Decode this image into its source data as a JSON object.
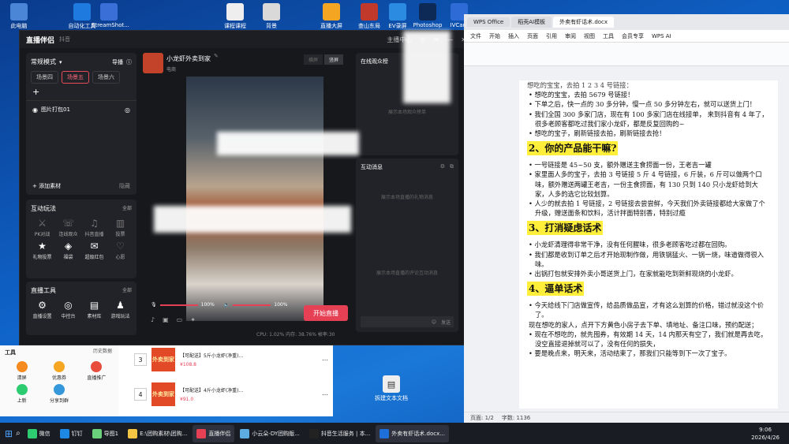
{
  "desktop": {
    "icons": [
      {
        "label": "此电脑"
      },
      {
        "label": "自动化工具"
      },
      {
        "label": "StreamShot..."
      },
      {
        "label": "课程课程"
      },
      {
        "label": "背景"
      },
      {
        "label": "直播大屏"
      },
      {
        "label": "查山东局"
      },
      {
        "label": "EV录屏"
      },
      {
        "label": "Photoshop"
      },
      {
        "label": "IVCam"
      }
    ],
    "bottom_file": "拆建文本文档"
  },
  "live_window": {
    "app_name": "直播伴侣",
    "platform": "抖音",
    "header_right": [
      "主播中心"
    ],
    "mode_label": "常规模式",
    "guide_label": "导播",
    "scenes": [
      "场景四",
      "场景五",
      "场景六"
    ],
    "active_scene": "场景五",
    "source_item": "图片打包01",
    "add_material": "添加素材",
    "hide_label": "隐藏",
    "interactive_title": "互动玩法",
    "all_label": "全部",
    "interactive_tools": [
      {
        "label": "PK对战",
        "enabled": false
      },
      {
        "label": "连线观众",
        "enabled": false
      },
      {
        "label": "抖音直播",
        "enabled": false
      },
      {
        "label": "投票",
        "enabled": false
      },
      {
        "label": "礼物投票",
        "enabled": true
      },
      {
        "label": "福袋",
        "enabled": true
      },
      {
        "label": "超级红包",
        "enabled": true
      },
      {
        "label": "心愿",
        "enabled": false
      }
    ],
    "live_tools_title": "直播工具",
    "live_tools": [
      {
        "label": "直播设置"
      },
      {
        "label": "中控台"
      },
      {
        "label": "素材库"
      },
      {
        "label": "游戏玩法"
      }
    ],
    "streamer_name": "小龙虾外卖到家",
    "streamer_tag": "电商",
    "orientation_options": [
      "横屏",
      "竖屏"
    ],
    "mic_volume": "100%",
    "speaker_volume": "100%",
    "start_live_label": "开始直播",
    "perf_status": "CPU: 1.02%  内存: 38.76%  帧率:30",
    "viewers_title": "在线观众榜",
    "viewers_empty": "展示本场观众榜单",
    "interact_title": "互动消息",
    "gift_empty": "展示本场直播的礼物消息",
    "comment_empty": "展示本场直播的评论互动消息",
    "chat_send": "发送"
  },
  "shop": {
    "left_title": "工具",
    "left_tools": [
      "清屏",
      "优惠券",
      "直播推广",
      "上新",
      "分享到群"
    ],
    "history_label": "历史数据",
    "products": [
      {
        "index": "3",
        "thumb": "外卖到家",
        "title": "【可配送】5斤小龙虾(净重)...",
        "price": "¥108.8"
      },
      {
        "index": "4",
        "thumb": "外卖到家",
        "title": "【可配送】4斤小龙虾(净重)...",
        "price": "¥91.0"
      }
    ]
  },
  "wps": {
    "tabs": [
      "WPS Office",
      "稻壳AI模板",
      "外卖有虾话术.docx"
    ],
    "active_tab": "外卖有虾话术.docx",
    "menu": [
      "文件",
      "开始",
      "插入",
      "页面",
      "引用",
      "审阅",
      "视图",
      "工具",
      "会员专享",
      "WPS AI"
    ],
    "doc": {
      "top_line": "想吃的宝宝，去拍 1 2 3 4 号链接：",
      "section1_bullets": [
        "• 想吃的宝宝，去拍 5679 号链接！",
        "• 下单之后，快一点的 30 多分钟，慢一点 50 多分钟左右，就可以送货上门！",
        "• 我们全国 300 多家门店，现在有 100 多家门店在线接单， 来到抖音有 4 年了，很多老顾客都吃过我们家小龙虾，都是反复回购的~",
        "• 想吃的宝子，刷新链接去拍，刷新链接去抢！"
      ],
      "h2": "2、你的产品能干嘛?",
      "section2_bullets": [
        "• 一号链接是 45~50 支，额外赠送主食捞面一份，王老吉一罐",
        "• 家里面人多的宝子，去拍 3 号链接 5 斤  4 号链接，6 斤装，6 斤可以做两个口味，额外赠送两罐王老吉，一份主食捞面，有 130 只到 140 只小龙虾给到大家，人多的选它比较划算。",
        "• 人少的就去拍 1 号链接，2 号链接去尝尝鲜，今天我们外卖链接都给大家做了个升级，赠送面条和饮料，活计拌面特别香，特别过瘾"
      ],
      "h3": "3、打消疑虑话术",
      "section3_bullets": [
        "• 小龙虾清理得非常干净，没有任何腥味，很多老顾客吃过都在回购。",
        "• 我们都是收到订单之后才开始现制作做，用铁锅猛火、一锅一烧，味道做得很入味。",
        "• 出锅打包就安排外卖小哥送货上门，在家就能吃到新鲜现烧的小龙虾。"
      ],
      "h4": "4、逼单话术",
      "section4_lines": [
        "• 今天给线下门店做宣传，给品质做品宣，才有这么划算的价格，错过就没这个价了。",
        "现在想吃的家人，点开下方黄色小房子去下单、填地址、备注口味，预约配送；",
        "• 现在不想吃的，就先囤券，有效期 14 天，14 内那天有空了，我们就是再去吃，没空直接退掉就可以了，没有任何的损失，",
        "• 要是晚点来，明天来，活动结束了，那我们只能等到下一次了宝子。"
      ]
    },
    "status": {
      "page": "页面: 1/2",
      "words": "字数: 1136"
    }
  },
  "taskbar": {
    "items": [
      {
        "label": "微信"
      },
      {
        "label": "钉钉"
      },
      {
        "label": "导图1"
      },
      {
        "label": "E:\\团购素材\\团购..."
      },
      {
        "label": "直播伴侣"
      },
      {
        "label": "小云朵-DY团购版..."
      },
      {
        "label": "抖音生活服务 | 本..."
      },
      {
        "label": "外卖有虾话术.docx..."
      }
    ],
    "time": "9:06",
    "date": "2026/4/26"
  },
  "colors": {
    "accent_red": "#e64055",
    "highlight_yellow": "#ffef3a",
    "dark_panel": "#222328"
  }
}
